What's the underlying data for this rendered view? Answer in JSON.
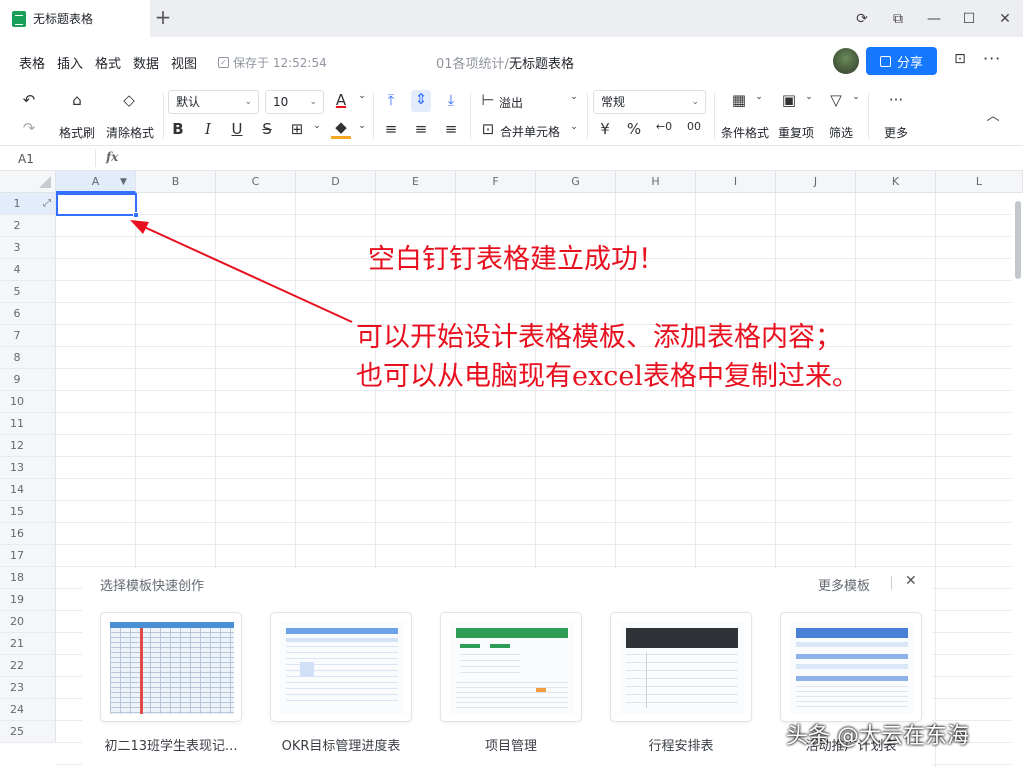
{
  "tab": {
    "title": "无标题表格",
    "new_tab": "+"
  },
  "window": {
    "sync": "⟳",
    "history": "⧉",
    "minimize": "—",
    "maximize": "☐",
    "close": "✕"
  },
  "menu": {
    "items": [
      "表格",
      "插入",
      "格式",
      "数据",
      "视图"
    ],
    "saved": "保存于 12:52:54",
    "doc_path_prefix": "01各项统计",
    "doc_path_sep": "/",
    "doc_title": "无标题表格",
    "share": "分享"
  },
  "toolbar": {
    "format_painter": "格式刷",
    "clear_format": "清除格式",
    "font_family": "默认",
    "font_size": "10",
    "text_color_letter": "A",
    "overflow": "溢出",
    "merge": "合并单元格",
    "number_format": "常规",
    "currency": "¥",
    "percent": "%",
    "conditional": "条件格式",
    "duplicates": "重复项",
    "filter": "筛选",
    "more": "更多",
    "bold": "B",
    "italic": "I",
    "underline": "U",
    "strike": "S"
  },
  "formula_bar": {
    "cell_ref": "A1",
    "fx": "fx"
  },
  "columns": [
    "A",
    "B",
    "C",
    "D",
    "E",
    "F",
    "G",
    "H",
    "I",
    "J",
    "K",
    "L"
  ],
  "rows": [
    "1",
    "2",
    "3",
    "4",
    "5",
    "6",
    "7",
    "8",
    "9",
    "10",
    "11",
    "12",
    "13",
    "14",
    "15",
    "16",
    "17",
    "18",
    "19",
    "20",
    "21",
    "22",
    "23",
    "24",
    "25"
  ],
  "annotations": {
    "line1": "空白钉钉表格建立成功！",
    "line2": "可以开始设计表格模板、添加表格内容；",
    "line3": "也可以从电脑现有excel表格中复制过来。"
  },
  "template_panel": {
    "title": "选择模板快速创作",
    "more": "更多模板",
    "close": "✕",
    "cards": [
      {
        "label": "初二13班学生表现记..."
      },
      {
        "label": "OKR目标管理进度表"
      },
      {
        "label": "项目管理"
      },
      {
        "label": "行程安排表"
      },
      {
        "label": "活动推广计划表"
      }
    ]
  },
  "watermark": "头条 @大云在东海",
  "colors": {
    "accent": "#1677ff",
    "annotation": "#e8101e",
    "selection": "#3370ff"
  }
}
